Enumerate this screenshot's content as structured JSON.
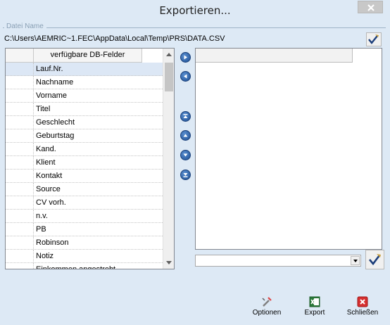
{
  "window": {
    "title": "Exportieren..."
  },
  "file": {
    "legend": "Datei Name",
    "path": "C:\\Users\\AEMRIC~1.FEC\\AppData\\Local\\Temp\\PRS\\DATA.CSV"
  },
  "left_list": {
    "header": "verfügbare DB-Felder",
    "items": [
      "Lauf.Nr.",
      "Nachname",
      "Vorname",
      "Titel",
      "Geschlecht",
      "Geburtstag",
      "Kand.",
      "Klient",
      "Kontakt",
      "Source",
      "CV vorh.",
      "n.v.",
      "PB",
      "Robinson",
      "Notiz",
      "Einkommen angestrebt"
    ],
    "selected_index": 0
  },
  "right_list": {
    "header": "",
    "items": []
  },
  "combo": {
    "value": ""
  },
  "buttons": {
    "options": "Optionen",
    "export": "Export",
    "close": "Schließen"
  },
  "icons": {
    "close": "close-x-icon",
    "browse": "checkmark-pencil-icon",
    "move_right": "arrow-right-icon",
    "move_left": "arrow-left-icon",
    "move_top": "arrow-top-icon",
    "move_up": "arrow-up-icon",
    "move_down": "arrow-down-icon",
    "move_bottom": "arrow-bottom-icon"
  },
  "colors": {
    "window_bg": "#dde9f5",
    "selection": "#dce7f5",
    "arrow_button": "#1e4f94"
  }
}
